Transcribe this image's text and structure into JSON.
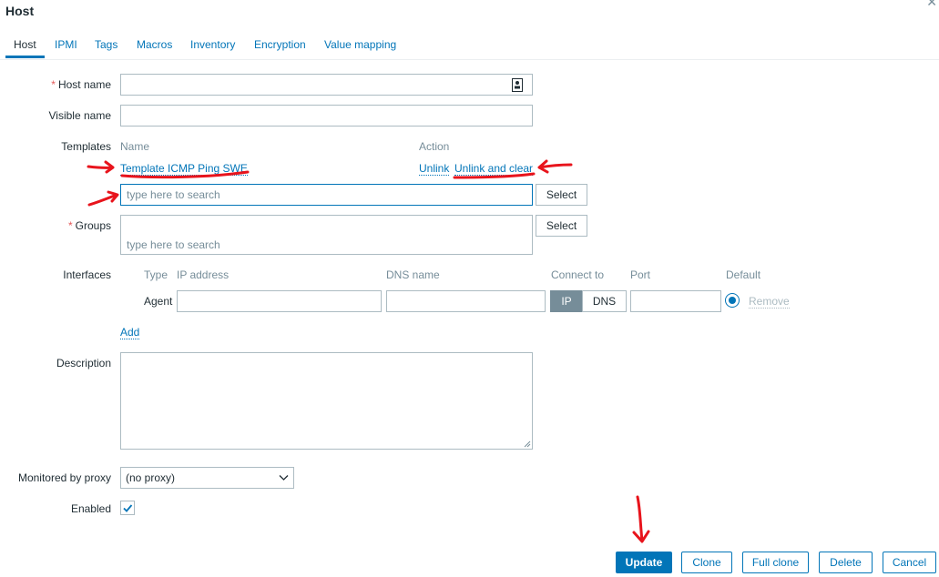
{
  "dialog": {
    "title": "Host"
  },
  "tabs": [
    {
      "label": "Host"
    },
    {
      "label": "IPMI"
    },
    {
      "label": "Tags"
    },
    {
      "label": "Macros"
    },
    {
      "label": "Inventory"
    },
    {
      "label": "Encryption"
    },
    {
      "label": "Value mapping"
    }
  ],
  "form": {
    "host_name": {
      "label": "Host name",
      "required_mark": "*",
      "value": ""
    },
    "visible_name": {
      "label": "Visible name",
      "value": ""
    },
    "templates": {
      "label": "Templates",
      "col_name": "Name",
      "col_action": "Action",
      "linked": [
        {
          "name": "Template ICMP Ping SWE",
          "unlink": "Unlink",
          "unlink_clear": "Unlink and clear"
        }
      ],
      "search_placeholder": "type here to search",
      "select_button": "Select"
    },
    "groups": {
      "label": "Groups",
      "required_mark": "*",
      "placeholder": "type here to search",
      "select_button": "Select"
    },
    "interfaces": {
      "label": "Interfaces",
      "col_type": "Type",
      "col_ip": "IP address",
      "col_dns": "DNS name",
      "col_connect": "Connect to",
      "col_port": "Port",
      "col_default": "Default",
      "rows": [
        {
          "type": "Agent",
          "ip": "",
          "dns": "",
          "connect_ip": "IP",
          "connect_dns": "DNS",
          "port": "",
          "remove": "Remove"
        }
      ],
      "add": "Add"
    },
    "description": {
      "label": "Description",
      "value": ""
    },
    "proxy": {
      "label": "Monitored by proxy",
      "selected": "(no proxy)"
    },
    "enabled": {
      "label": "Enabled",
      "checked": true
    }
  },
  "footer": {
    "update": "Update",
    "clone": "Clone",
    "full_clone": "Full clone",
    "delete": "Delete",
    "cancel": "Cancel"
  },
  "colors": {
    "accent": "#0275b8",
    "annotation": "#e8141c",
    "required": "#e45959"
  }
}
